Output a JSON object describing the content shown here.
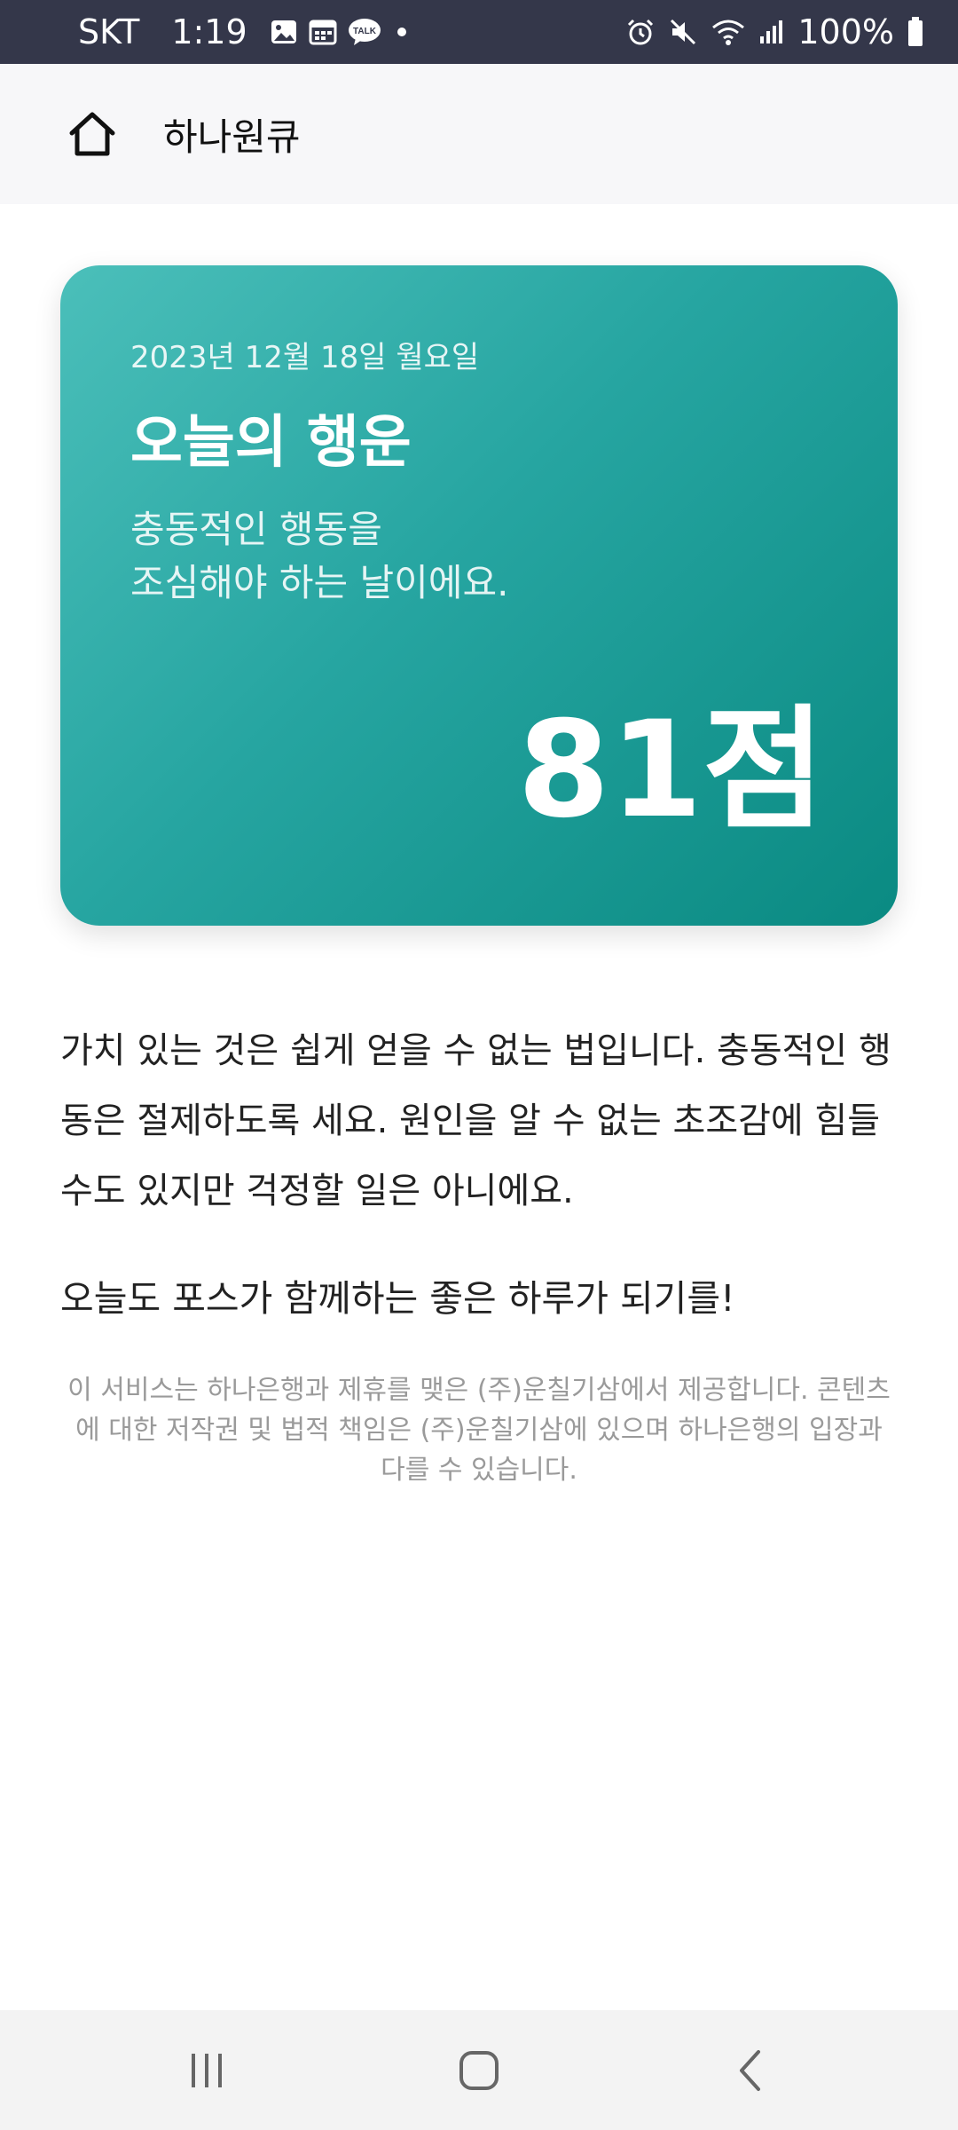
{
  "status_bar": {
    "carrier": "SKT",
    "time": "1:19",
    "notification_icons": [
      "gallery-icon",
      "calendar-icon",
      "kakaotalk-icon",
      "dot-icon"
    ],
    "kakaotalk_badge": "TALK",
    "system_icons": [
      "alarm-icon",
      "mute-icon",
      "wifi-icon",
      "signal-icon",
      "battery-icon"
    ],
    "battery": "100%"
  },
  "header": {
    "title": "하나원큐",
    "home_icon": "home-icon"
  },
  "fortune_card": {
    "date": "2023년 12월 18일 월요일",
    "title": "오늘의 행운",
    "message_line1": "충동적인 행동을",
    "message_line2": "조심해야 하는 날이에요.",
    "score": "81점",
    "gradient_start": "#4bbfba",
    "gradient_end": "#0a8a82"
  },
  "content": {
    "description_line1": "가치 있는 것은 쉽게 얻을 수 없는 법입니다. 충동적인 행",
    "description_line2": "동은 절제하도록 세요. 원인을 알 수 없는 초조감에 힘들",
    "description_line3": "수도 있지만 걱정할 일은 아니에요.",
    "closing": "오늘도 포스가 함께하는 좋은 하루가 되기를!",
    "disclaimer_line1": "이 서비스는 하나은행과 제휴를 맺은 (주)운칠기삼에서 제공합니다. 콘텐츠",
    "disclaimer_line2": "에 대한 저작권 및 법적 책임은 (주)운칠기삼에 있으며 하나은행의 입장과",
    "disclaimer_line3": "다를 수 있습니다."
  },
  "nav_bar": {
    "buttons": [
      "recent-apps-icon",
      "home-button-icon",
      "back-icon"
    ]
  }
}
